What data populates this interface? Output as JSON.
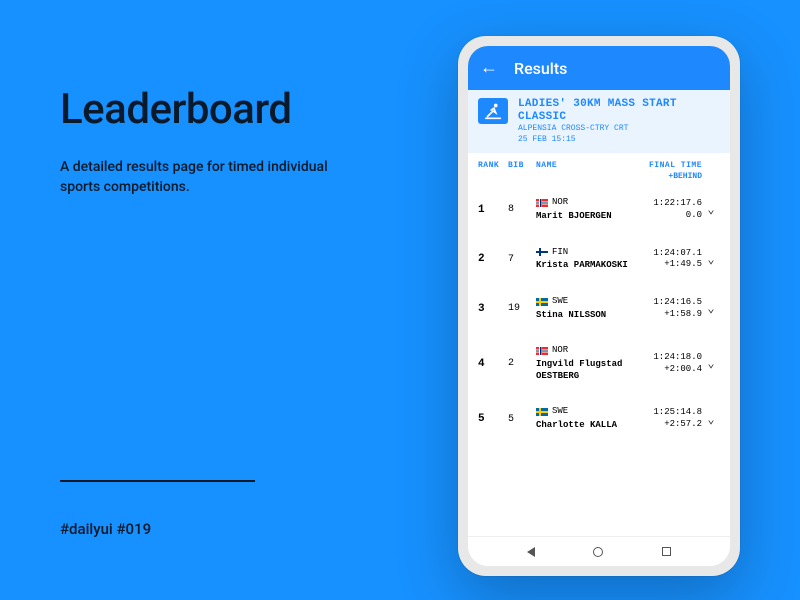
{
  "page": {
    "title": "Leaderboard",
    "description": "A detailed results page for timed individual sports competitions.",
    "hashtags": "#dailyui #019"
  },
  "appbar": {
    "title": "Results"
  },
  "event": {
    "title": "LADIES' 30KM MASS START CLASSIC",
    "venue": "ALPENSIA CROSS-CTRY CRT",
    "datetime": "25 FEB 15:15"
  },
  "columns": {
    "rank": "RANK",
    "bib": "BIB",
    "name": "NAME",
    "time": "FINAL TIME",
    "behind": "+BEHIND"
  },
  "results": [
    {
      "rank": "1",
      "bib": "8",
      "country_code": "NOR",
      "flag": "nor",
      "athlete": "Marit BJOERGEN",
      "final_time": "1:22:17.6",
      "behind": "0.0"
    },
    {
      "rank": "2",
      "bib": "7",
      "country_code": "FIN",
      "flag": "fin",
      "athlete": "Krista PARMAKOSKI",
      "final_time": "1:24:07.1",
      "behind": "+1:49.5"
    },
    {
      "rank": "3",
      "bib": "19",
      "country_code": "SWE",
      "flag": "swe",
      "athlete": "Stina NILSSON",
      "final_time": "1:24:16.5",
      "behind": "+1:58.9"
    },
    {
      "rank": "4",
      "bib": "2",
      "country_code": "NOR",
      "flag": "nor",
      "athlete": "Ingvild Flugstad OESTBERG",
      "final_time": "1:24:18.0",
      "behind": "+2:00.4"
    },
    {
      "rank": "5",
      "bib": "5",
      "country_code": "SWE",
      "flag": "swe",
      "athlete": "Charlotte KALLA",
      "final_time": "1:25:14.8",
      "behind": "+2:57.2"
    }
  ]
}
